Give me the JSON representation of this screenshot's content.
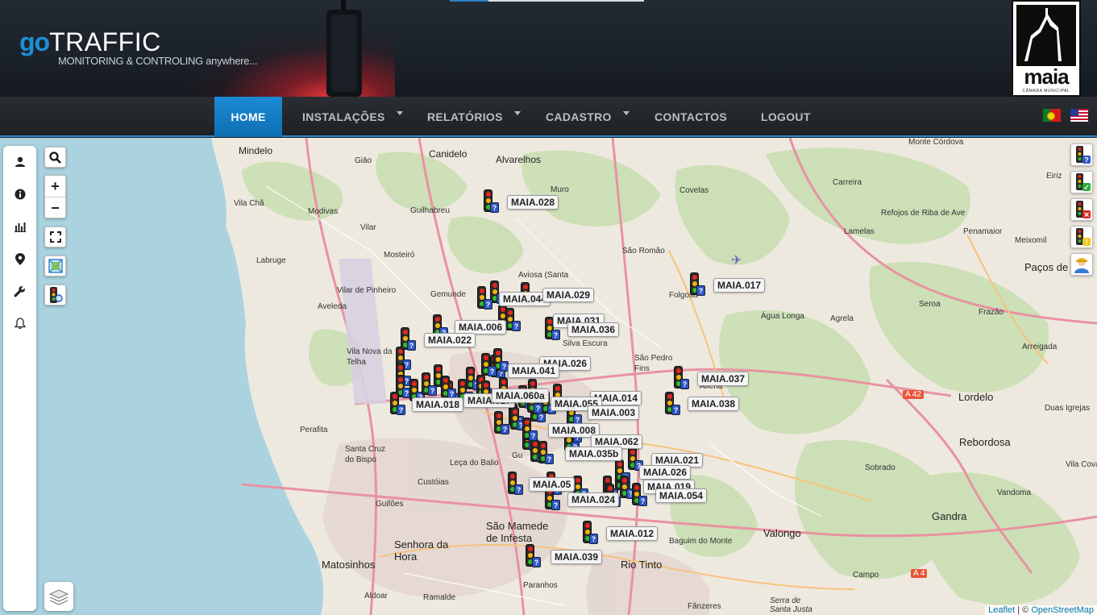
{
  "brand": {
    "logo_go": "go",
    "logo_rest": "TRAFFIC",
    "tagline": "MONITORING & CONTROLING anywhere..."
  },
  "city_logo": {
    "name": "maia",
    "subtitle": "CÂMARA MUNICIPAL"
  },
  "nav": {
    "home": "HOME",
    "instalacoes": "INSTALAÇÕES",
    "relatorios": "RELATÓRIOS",
    "cadastro": "CADASTRO",
    "contactos": "CONTACTOS",
    "logout": "LOGOUT"
  },
  "sidebar": {
    "items": [
      {
        "icon": "user-icon"
      },
      {
        "icon": "info-icon"
      },
      {
        "icon": "bar-chart-icon"
      },
      {
        "icon": "map-pin-icon"
      },
      {
        "icon": "wrench-icon"
      },
      {
        "icon": "bell-icon"
      }
    ]
  },
  "map_controls": {
    "zoom_in": "+",
    "zoom_out": "−"
  },
  "legend": [
    {
      "icon": "traffic-light-unknown-icon",
      "badge": "?",
      "badge_color": "#2f56c6"
    },
    {
      "icon": "traffic-light-ok-icon",
      "badge": "✓",
      "badge_color": "#2cab3a"
    },
    {
      "icon": "traffic-light-error-icon",
      "badge": "✕",
      "badge_color": "#d5261f"
    },
    {
      "icon": "traffic-light-warning-icon",
      "badge": "!",
      "badge_color": "#f0c419"
    },
    {
      "icon": "technician-icon"
    }
  ],
  "markers": [
    {
      "label": "MAIA.028"
    },
    {
      "label": "MAIA.017"
    },
    {
      "label": "MAIA.044"
    },
    {
      "label": "MAIA.029"
    },
    {
      "label": "MAIA.006"
    },
    {
      "label": "MAIA.031"
    },
    {
      "label": "MAIA.036"
    },
    {
      "label": "MAIA.022"
    },
    {
      "label": "MAIA.026"
    },
    {
      "label": "MAIA.041"
    },
    {
      "label": "MAIA.037"
    },
    {
      "label": "MAIA.018"
    },
    {
      "label": "MAIA.027"
    },
    {
      "label": "MAIA.060a"
    },
    {
      "label": "MAIA.014"
    },
    {
      "label": "MAIA.055"
    },
    {
      "label": "MAIA.038"
    },
    {
      "label": "MAIA.003"
    },
    {
      "label": "MAIA.008"
    },
    {
      "label": "MAIA.062"
    },
    {
      "label": "MAIA.035b"
    },
    {
      "label": "MAIA.021"
    },
    {
      "label": "MAIA.026"
    },
    {
      "label": "MAIA.05"
    },
    {
      "label": "MAIA.019"
    },
    {
      "label": "MAIA.024"
    },
    {
      "label": "MAIA.054"
    },
    {
      "label": "MAIA.012"
    },
    {
      "label": "MAIA.039"
    }
  ],
  "places": [
    "Mindelo",
    "Canidelo",
    "Alvarelhos",
    "Muro",
    "Covelas",
    "Carreira",
    "Monte Córdova",
    "Giāo",
    "Guilhabreu",
    "Eiriz",
    "Vila Chã",
    "Modivas",
    "Refojos de Riba de Ave",
    "Vilar",
    "Lamelas",
    "Penamaior",
    "Meixomil",
    "Mosteiró",
    "São Romão",
    "Labruge",
    "Paços de",
    "Vilar de Pinheiro",
    "Gemunde",
    "Aviosa (Santa",
    "Folgosa",
    "Aveleda",
    "Água Longa",
    "Seroa",
    "Frazão",
    "Agrela",
    "Silva Escura",
    "São Pedro Fins",
    "Vila Nova da Telha",
    "Arreigada",
    "Alfena",
    "Lordelo",
    "Duas Igrejas",
    "Perafita",
    "Santa Cruz do Bispo",
    "Leça do Balio",
    "Rebordosa",
    "Sobrado",
    "Custóias",
    "Guifões",
    "São Mamede de Infesta",
    "Valongo",
    "Vandoma",
    "Gandra",
    "Senhora da Hora",
    "Baguim do Monte",
    "Matosinhos",
    "Rio Tinto",
    "Campo",
    "Aldoar",
    "Ramalde",
    "Paranhos",
    "Fânzeres",
    "Serra de Santa Justa",
    "Vila Cova",
    "Gu",
    "A 42",
    "A 4"
  ],
  "attribution": {
    "leaflet": "Leaflet",
    "sep": " | © ",
    "osm": "OpenStreetMap"
  }
}
